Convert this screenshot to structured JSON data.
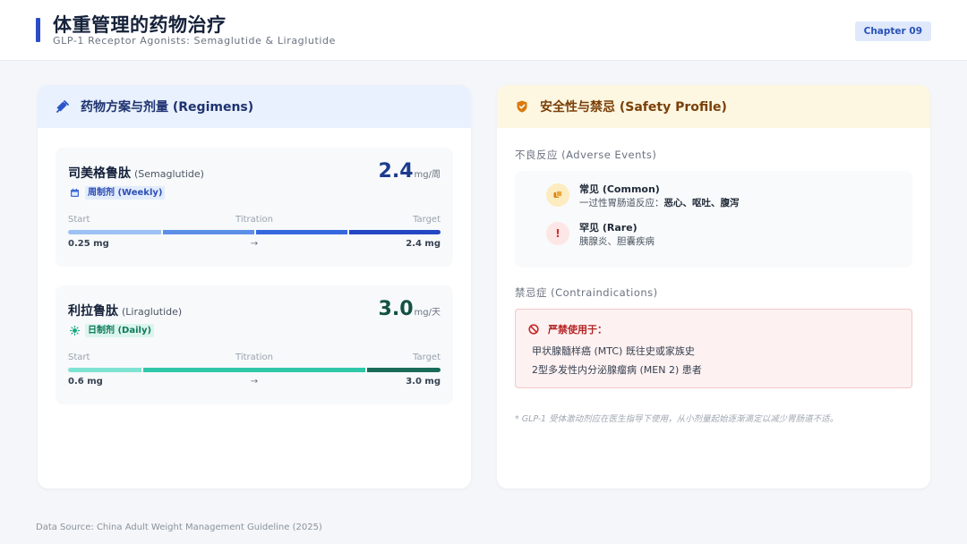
{
  "header": {
    "title": "体重管理的药物治疗",
    "subtitle": "GLP-1 Receptor Agonists: Semaglutide & Liraglutide",
    "chapter": "Chapter 09",
    "accent_color": "#2b4cc4"
  },
  "regimens": {
    "heading": "药物方案与剂量 (Regimens)",
    "heading_icon": "syringe-icon",
    "drugs": [
      {
        "name_cn": "司美格鲁肽",
        "name_en": "(Semaglutide)",
        "dose_value": "2.4",
        "dose_unit": "mg/周",
        "frequency": "周制剂 (Weekly)",
        "frequency_icon": "calendar-icon",
        "stage_start": "Start",
        "stage_mid": "Titration",
        "stage_end": "Target",
        "start_dose": "0.25 mg",
        "arrow": "→",
        "target_dose": "2.4 mg",
        "bar_colors": [
          "#9cc2f5",
          "#5b8fe8",
          "#3567de",
          "#2447c4"
        ]
      },
      {
        "name_cn": "利拉鲁肽",
        "name_en": "(Liraglutide)",
        "dose_value": "3.0",
        "dose_unit": "mg/天",
        "frequency": "日制剂 (Daily)",
        "frequency_icon": "sun-icon",
        "stage_start": "Start",
        "stage_mid": "Titration",
        "stage_end": "Target",
        "start_dose": "0.6 mg",
        "arrow": "→",
        "target_dose": "3.0 mg",
        "bar_colors": [
          "#7ee3d2",
          "#2fc7a8",
          "#1a6b5a"
        ]
      }
    ]
  },
  "safety": {
    "heading": "安全性与禁忌 (Safety Profile)",
    "heading_icon": "shield-icon",
    "adverse_label": "不良反应 (Adverse Events)",
    "common": {
      "title": "常见 (Common)",
      "desc_prefix": "一过性胃肠道反应：",
      "desc_bold": "恶心、呕吐、腹泻",
      "icon": "pills-icon"
    },
    "rare": {
      "title": "罕见 (Rare)",
      "desc": "胰腺炎、胆囊疾病",
      "icon": "exclamation-icon",
      "glyph": "!"
    },
    "contra_label": "禁忌症 (Contraindications)",
    "contra_head": "严禁使用于：",
    "contra_icon": "ban-icon",
    "contra_items": [
      "甲状腺髓样癌 (MTC) 既往史或家族史",
      "2型多发性内分泌腺瘤病 (MEN 2) 患者"
    ],
    "footnote": "* GLP-1 受体激动剂应在医生指导下使用，从小剂量起始逐渐滴定以减少胃肠道不适。"
  },
  "footer": {
    "source": "Data Source: China Adult Weight Management Guideline (2025)"
  }
}
